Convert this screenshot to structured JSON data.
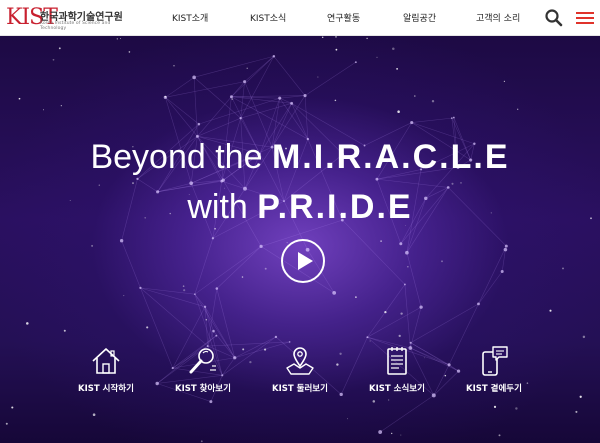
{
  "header": {
    "logo_mark": "KIST",
    "logo_korean": "한국과학기술연구원",
    "logo_english": "Korea Institute of Science and Technology",
    "nav": [
      {
        "label": "KIST소개"
      },
      {
        "label": "KIST소식"
      },
      {
        "label": "연구활동"
      },
      {
        "label": "알림공간"
      },
      {
        "label": "고객의 소리"
      }
    ],
    "search_icon": "search-icon",
    "menu_icon": "hamburger-menu-icon"
  },
  "hero": {
    "line1_light": "Beyond the",
    "line1_bold": "M.I.R.A.C.L.E",
    "line2_light": "with",
    "line2_bold": "P.R.I.D.E",
    "play_icon": "play-icon"
  },
  "quick_links": [
    {
      "label": "KIST 시작하기",
      "icon": "house-icon"
    },
    {
      "label": "KIST 찾아보기",
      "icon": "magnifier-icon"
    },
    {
      "label": "KIST 둘러보기",
      "icon": "map-pin-icon"
    },
    {
      "label": "KIST 소식보기",
      "icon": "notepad-icon"
    },
    {
      "label": "KIST 곁에두기",
      "icon": "mobile-chat-icon"
    }
  ],
  "colors": {
    "brand_red": "#c8202f",
    "menu_red": "#e0332b",
    "hero_purple": "#2a1060"
  }
}
